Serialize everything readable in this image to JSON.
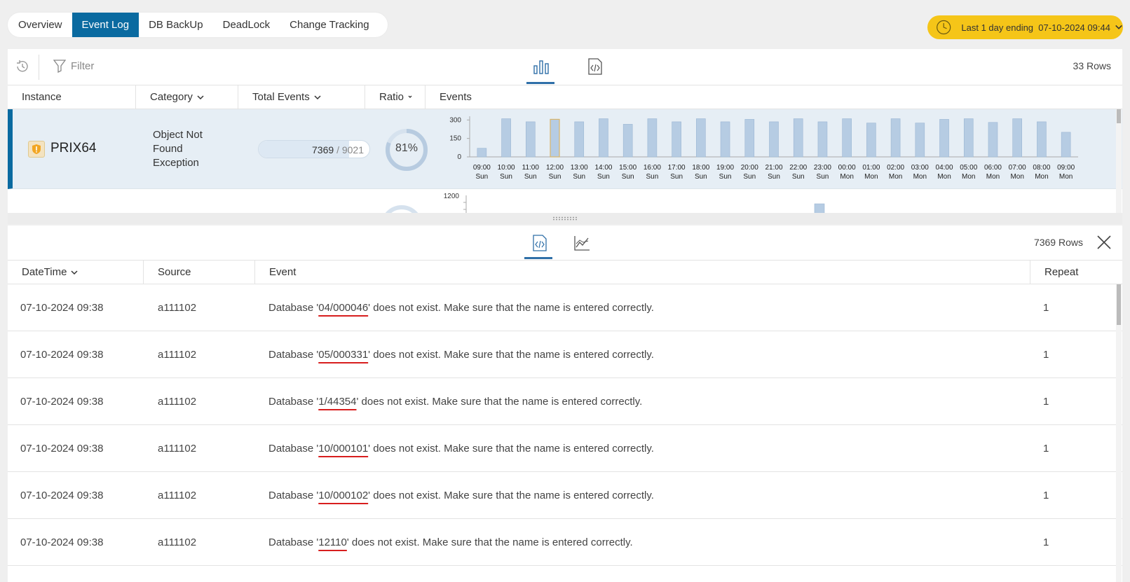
{
  "tabs": [
    {
      "label": "Overview",
      "active": false
    },
    {
      "label": "Event Log",
      "active": true
    },
    {
      "label": "DB BackUp",
      "active": false
    },
    {
      "label": "DeadLock",
      "active": false
    },
    {
      "label": "Change Tracking",
      "active": false
    }
  ],
  "time_range": {
    "prefix": "Last 1 day ending",
    "value": "07-10-2024 09:44",
    "color": "#f5c518"
  },
  "top_toolbar": {
    "filter_placeholder": "Filter",
    "row_count": "33 Rows"
  },
  "top_columns": [
    "Instance",
    "Category",
    "Total Events",
    "Ratio",
    "Events"
  ],
  "selected_row": {
    "instance": "PRIX64",
    "category": "Object Not Found Exception",
    "total_events": "7369",
    "total_all": "9021",
    "ratio": "81%",
    "ratio_value": 0.81
  },
  "chart_data": [
    {
      "type": "bar",
      "yticks": [
        "300",
        "150",
        "0"
      ],
      "ylim": [
        0,
        330
      ],
      "categories": [
        "09:00 Sun",
        "10:00 Sun",
        "11:00 Sun",
        "12:00 Sun",
        "13:00 Sun",
        "14:00 Sun",
        "15:00 Sun",
        "16:00 Sun",
        "17:00 Sun",
        "18:00 Sun",
        "19:00 Sun",
        "20:00 Sun",
        "21:00 Sun",
        "22:00 Sun",
        "23:00 Sun",
        "00:00 Mon",
        "01:00 Mon",
        "02:00 Mon",
        "03:00 Mon",
        "04:00 Mon",
        "05:00 Mon",
        "06:00 Mon",
        "07:00 Mon",
        "08:00 Mon",
        "09:00 Mon"
      ],
      "xtick_time": [
        "09:00",
        "10:00",
        "11:00",
        "12:00",
        "13:00",
        "14:00",
        "15:00",
        "16:00",
        "17:00",
        "18:00",
        "19:00",
        "20:00",
        "21:00",
        "22:00",
        "23:00",
        "00:00",
        "01:00",
        "02:00",
        "03:00",
        "04:00",
        "05:00",
        "06:00",
        "07:00",
        "08:00",
        "09:00"
      ],
      "xtick_day": [
        "Sun",
        "Sun",
        "Sun",
        "Sun",
        "Sun",
        "Sun",
        "Sun",
        "Sun",
        "Sun",
        "Sun",
        "Sun",
        "Sun",
        "Sun",
        "Sun",
        "Sun",
        "Mon",
        "Mon",
        "Mon",
        "Mon",
        "Mon",
        "Mon",
        "Mon",
        "Mon",
        "Mon",
        "Mon"
      ],
      "values": [
        70,
        310,
        285,
        305,
        285,
        310,
        265,
        310,
        285,
        310,
        285,
        305,
        285,
        310,
        285,
        310,
        275,
        310,
        275,
        305,
        310,
        280,
        310,
        285,
        200
      ],
      "highlight_index": 3,
      "color": "#b6cce3"
    },
    {
      "type": "bar",
      "yticks": [
        "1200"
      ],
      "note": "partially visible second row"
    }
  ],
  "bottom_toolbar": {
    "row_count": "7369 Rows"
  },
  "bottom_columns": [
    "DateTime",
    "Source",
    "Event",
    "Repeat"
  ],
  "events": [
    {
      "datetime": "07-10-2024 09:38",
      "source": "a111102",
      "pre": "Database '",
      "db": "04/000046",
      "post": "' does not exist. Make sure that the name is entered correctly.",
      "repeat": "1"
    },
    {
      "datetime": "07-10-2024 09:38",
      "source": "a111102",
      "pre": "Database '",
      "db": "05/000331",
      "post": "' does not exist. Make sure that the name is entered correctly.",
      "repeat": "1"
    },
    {
      "datetime": "07-10-2024 09:38",
      "source": "a111102",
      "pre": "Database '",
      "db": "1/44354",
      "post": "' does not exist. Make sure that the name is entered correctly.",
      "repeat": "1"
    },
    {
      "datetime": "07-10-2024 09:38",
      "source": "a111102",
      "pre": "Database '",
      "db": "10/000101",
      "post": "' does not exist. Make sure that the name is entered correctly.",
      "repeat": "1"
    },
    {
      "datetime": "07-10-2024 09:38",
      "source": "a111102",
      "pre": "Database '",
      "db": "10/000102",
      "post": "' does not exist. Make sure that the name is entered correctly.",
      "repeat": "1"
    },
    {
      "datetime": "07-10-2024 09:38",
      "source": "a111102",
      "pre": "Database '",
      "db": "12110",
      "post": "' does not exist. Make sure that the name is entered correctly.",
      "repeat": "1"
    }
  ]
}
